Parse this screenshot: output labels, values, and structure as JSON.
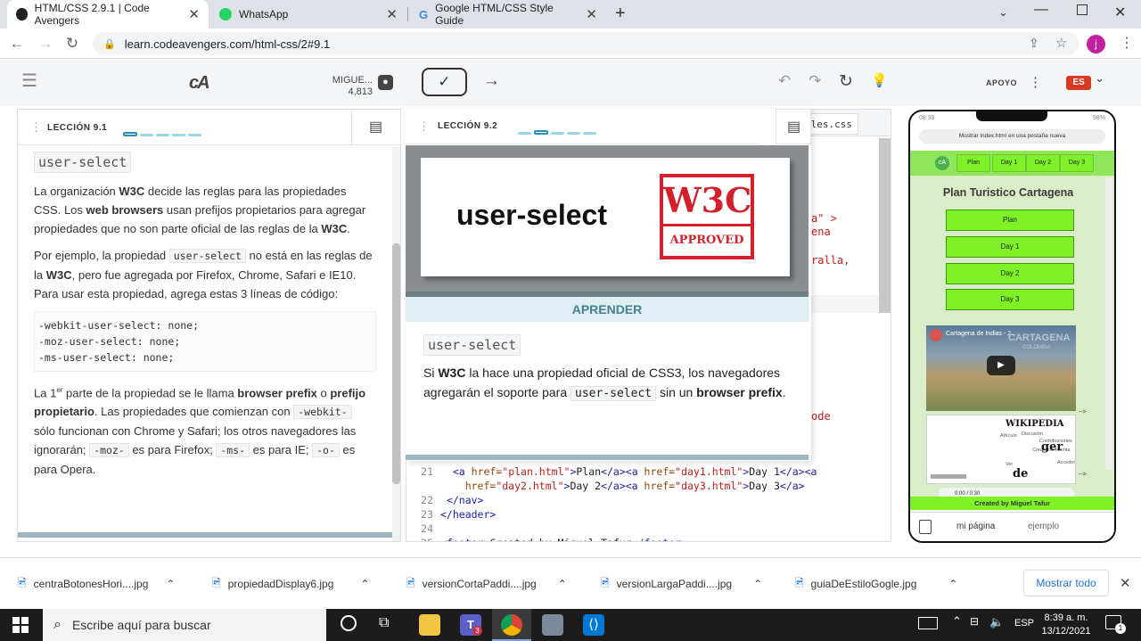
{
  "browser": {
    "tabs": [
      {
        "title": "HTML/CSS 2.9.1 | Code Avengers",
        "active": true
      },
      {
        "title": "WhatsApp",
        "active": false
      },
      {
        "title": "Google HTML/CSS Style Guide",
        "active": false
      }
    ],
    "url": "learn.codeavengers.com/html-css/2#9.1",
    "profile_initial": "j"
  },
  "app": {
    "logo": "cA",
    "user_name": "MIGUE...",
    "user_points": "4,813",
    "support_label": "APOYO",
    "language": "ES"
  },
  "left_panel": {
    "lesson_label": "LECCIÓN 9.1",
    "heading_code": "user-select",
    "p1": {
      "a": "La organización ",
      "b": "W3C",
      "c": " decide las reglas para las propiedades CSS. Los ",
      "d": "web browsers",
      "e": " usan prefijos propietarios para agregar propiedades que no son parte oficial de las reglas de la ",
      "f": "W3C",
      "g": "."
    },
    "p2": {
      "a": "Por ejemplo, la propiedad ",
      "code": "user-select",
      "b": " no está en las reglas de la ",
      "c": "W3C",
      "d": ", pero fue agregada por Firefox, Chrome, Safari e IE10. Para usar esta propiedad, agrega estas 3 líneas de código:"
    },
    "code_lines": [
      "-webkit-user-select: none;",
      "-moz-user-select: none;",
      "-ms-user-select: none;"
    ],
    "p3": {
      "a": "La 1",
      "sup": "er",
      "b": " parte de la propiedad se le llama ",
      "c": "browser prefix",
      "d": " o ",
      "e": "prefijo propietario",
      "f": ". Las propiedades que comienzan con ",
      "code1": "-webkit-",
      "g": " sólo funcionan con Chrome y Safari; los otros navegadores las ignorarán; ",
      "code2": "-moz-",
      "h": " es para Firefox; ",
      "code3": "-ms-",
      "i": " es para IE; ",
      "code4": "-o-",
      "j": " es para Opera."
    }
  },
  "middle_panel": {
    "lesson_label": "LECCIÓN 9.2",
    "banner_text": "user-select",
    "stamp_top": "W3C",
    "stamp_bottom": "APPROVED",
    "learn_label": "APRENDER",
    "heading_code": "user-select",
    "p": {
      "a": "Si ",
      "b": "W3C",
      "c": " la hace una propiedad oficial de CSS3, los navegadores agregarán el soporte para ",
      "code": "user-select",
      "d": " sin un ",
      "e": "browser prefix",
      "f": "."
    }
  },
  "editor": {
    "file_tab": "yles.css",
    "fragments": [
      "a\" >",
      "ena",
      "ralla,",
      "ode",
      "-->",
      "-->"
    ],
    "lines": [
      {
        "num": "21",
        "indent": "  ",
        "parts": [
          [
            "tg",
            "<a "
          ],
          [
            "at",
            "href="
          ],
          [
            "st",
            "\"plan.html\""
          ],
          [
            "tg",
            ">"
          ],
          [
            "tx",
            "Plan"
          ],
          [
            "tg",
            "</a><a "
          ],
          [
            "at",
            "href="
          ],
          [
            "st",
            "\"day1.html\""
          ],
          [
            "tg",
            ">"
          ],
          [
            "tx",
            "Day 1"
          ],
          [
            "tg",
            "</a><a"
          ]
        ]
      },
      {
        "num": "",
        "indent": "    ",
        "parts": [
          [
            "at",
            "href="
          ],
          [
            "st",
            "\"day2.html\""
          ],
          [
            "tg",
            ">"
          ],
          [
            "tx",
            "Day 2"
          ],
          [
            "tg",
            "</a><a "
          ],
          [
            "at",
            "href="
          ],
          [
            "st",
            "\"day3.html\""
          ],
          [
            "tg",
            ">"
          ],
          [
            "tx",
            "Day 3"
          ],
          [
            "tg",
            "</a>"
          ]
        ]
      },
      {
        "num": "22",
        "indent": " ",
        "parts": [
          [
            "tg",
            "</nav>"
          ]
        ]
      },
      {
        "num": "23",
        "indent": "",
        "parts": [
          [
            "tg",
            "</header>"
          ]
        ]
      },
      {
        "num": "24",
        "indent": "",
        "parts": []
      },
      {
        "num": "25",
        "indent": "",
        "parts": [
          [
            "tg",
            "<footer>"
          ],
          [
            "tx",
            "Created by Miguel Tafur"
          ],
          [
            "tg",
            "</footer>"
          ]
        ]
      }
    ]
  },
  "phone": {
    "time": "08:39",
    "battery": "98%",
    "open_tab_label": "Mostrar index.html en una pestaña nueva",
    "nav": [
      "Plan",
      "Day 1",
      "Day 2",
      "Day 3"
    ],
    "title": "Plan Turistico Cartagena",
    "buttons": [
      "Plan",
      "Day 1",
      "Day 2",
      "Day 3"
    ],
    "video_title": "Cartagena de Indias - 2...",
    "video_watermark": "CARTAGENA",
    "video_sub": "COLOMBIA",
    "wiki": [
      "WIKIPEDIA",
      "Artículo",
      "Discusión",
      "Contribuciones",
      "Crear una cuenta",
      "Ver",
      "Acceder",
      "ger",
      "de"
    ],
    "audio_time": "0:00 / 0:30",
    "footer": "Created by Miguel Tafur",
    "tabs": [
      "mi página",
      "ejemplo"
    ]
  },
  "downloads": {
    "files": [
      "centraBotonesHori....jpg",
      "propiedadDisplay6.jpg",
      "versionCortaPaddi....jpg",
      "versionLargaPaddi....jpg",
      "guiaDeEstiloGogle.jpg"
    ],
    "show_all": "Mostrar todo"
  },
  "taskbar": {
    "search_placeholder": "Escribe aquí para buscar",
    "lang": "ESP",
    "time": "8:39 a. m.",
    "date": "13/12/2021",
    "notifications": "1",
    "teams_badge": "3"
  },
  "colors": {
    "accent": "#2a8dbf",
    "green": "#7ef227",
    "stamp_red": "#d3202a",
    "learn_bar": "#deeef2"
  }
}
